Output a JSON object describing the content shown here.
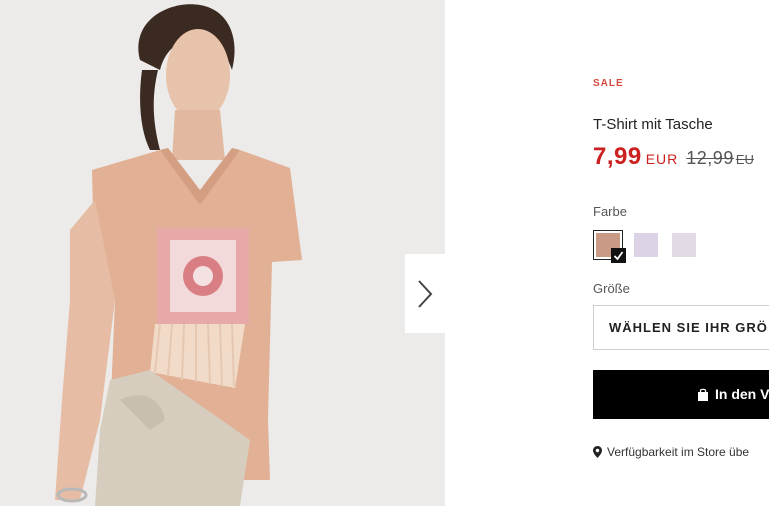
{
  "product": {
    "badge": "SALE",
    "title": "T-Shirt mit Tasche",
    "price_now": "7,99",
    "price_now_currency": "EUR",
    "price_old": "12,99",
    "price_old_currency": "EU"
  },
  "color": {
    "label": "Farbe",
    "swatches": [
      {
        "name": "rosé",
        "color": "#c99a86",
        "selected": true
      },
      {
        "name": "lavender-print",
        "color": "#dcd4e6",
        "selected": false
      },
      {
        "name": "lilac",
        "color": "#e2dbe6",
        "selected": false
      }
    ]
  },
  "size": {
    "label": "Größe",
    "select_placeholder": "WÄHLEN SIE IHR GRÖ"
  },
  "cart": {
    "button_label": "In den V"
  },
  "store": {
    "text": "Verfügbarkeit im Store übe"
  },
  "gallery": {
    "next_icon": "chevron-right-icon"
  },
  "colors": {
    "sale_red": "#cc1f1f",
    "badge_red": "#d64a3e",
    "button_black": "#000000"
  }
}
